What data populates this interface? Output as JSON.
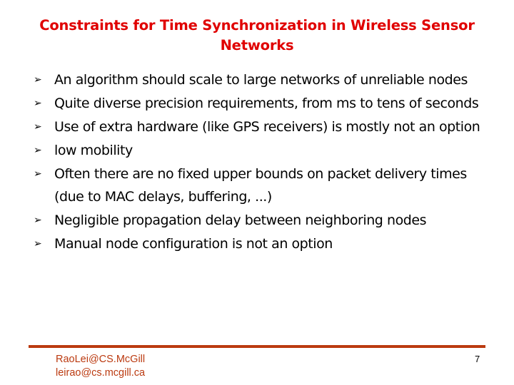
{
  "slide": {
    "title": "Constraints for Time Synchronization in Wireless Sensor Networks",
    "bullet_icon": "arrowhead-bullet",
    "bullet_glyph": "➢",
    "bullets": [
      "An algorithm should scale to large networks of unreliable nodes",
      "Quite diverse precision requirements, from ms to tens of seconds",
      "Use of extra hardware (like GPS receivers) is mostly not an option",
      "low mobility",
      "Often there are no fixed upper bounds on packet delivery times (due to MAC delays, buffering, ...)",
      "Negligible propagation delay between neighboring nodes",
      "Manual node configuration is not an option"
    ]
  },
  "footer": {
    "credit_line1": "RaoLei@CS.McGill",
    "credit_line2": "leirao@cs.mcgill.ca",
    "page_number": "7"
  },
  "colors": {
    "title": "#e00000",
    "body_text": "#000000",
    "footer_accent": "#bb3a10"
  }
}
